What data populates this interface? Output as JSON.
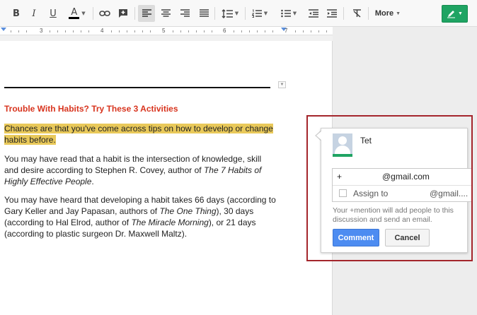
{
  "toolbar": {
    "bold": "B",
    "italic": "I",
    "underline": "U",
    "text_color": "A",
    "more_label": "More",
    "accent_color": "#1fa463"
  },
  "ruler": {
    "numbers": [
      "3",
      "4",
      "5",
      "6",
      "7"
    ]
  },
  "document": {
    "heading": "Trouble With Habits? Try These 3 Activities",
    "para1_line1": "Chances are that you've come across tips on how to develop or change",
    "para1_line2": "habits before.",
    "para2_a": "You may have read that a habit is the intersection of knowledge, skill and desire according to Stephen R. Covey, author of ",
    "para2_book": "The 7 Habits of Highly Effective People",
    "para2_b": ".",
    "para3_a": "You may have heard that developing a habit takes 66 days (according to Gary Keller and Jay Papasan, authors of ",
    "para3_book1": "The One Thing",
    "para3_b": "), 30 days (according to Hal Elrod, author of ",
    "para3_book2": "The Miracle Morning",
    "para3_c": "), or 21 days (according to plastic surgeon Dr. Maxwell Maltz).",
    "highlight_color": "#e9c95a",
    "heading_color": "#d8341e"
  },
  "comment": {
    "user_name": "Tet",
    "mention_prefix": "+",
    "mention_email": "@gmail.com",
    "assign_label": "Assign to",
    "assign_email": "@gmail....",
    "hint": "Your +mention will add people to this discussion and send an email.",
    "comment_button": "Comment",
    "cancel_button": "Cancel",
    "annotation_color": "#a4262c"
  }
}
